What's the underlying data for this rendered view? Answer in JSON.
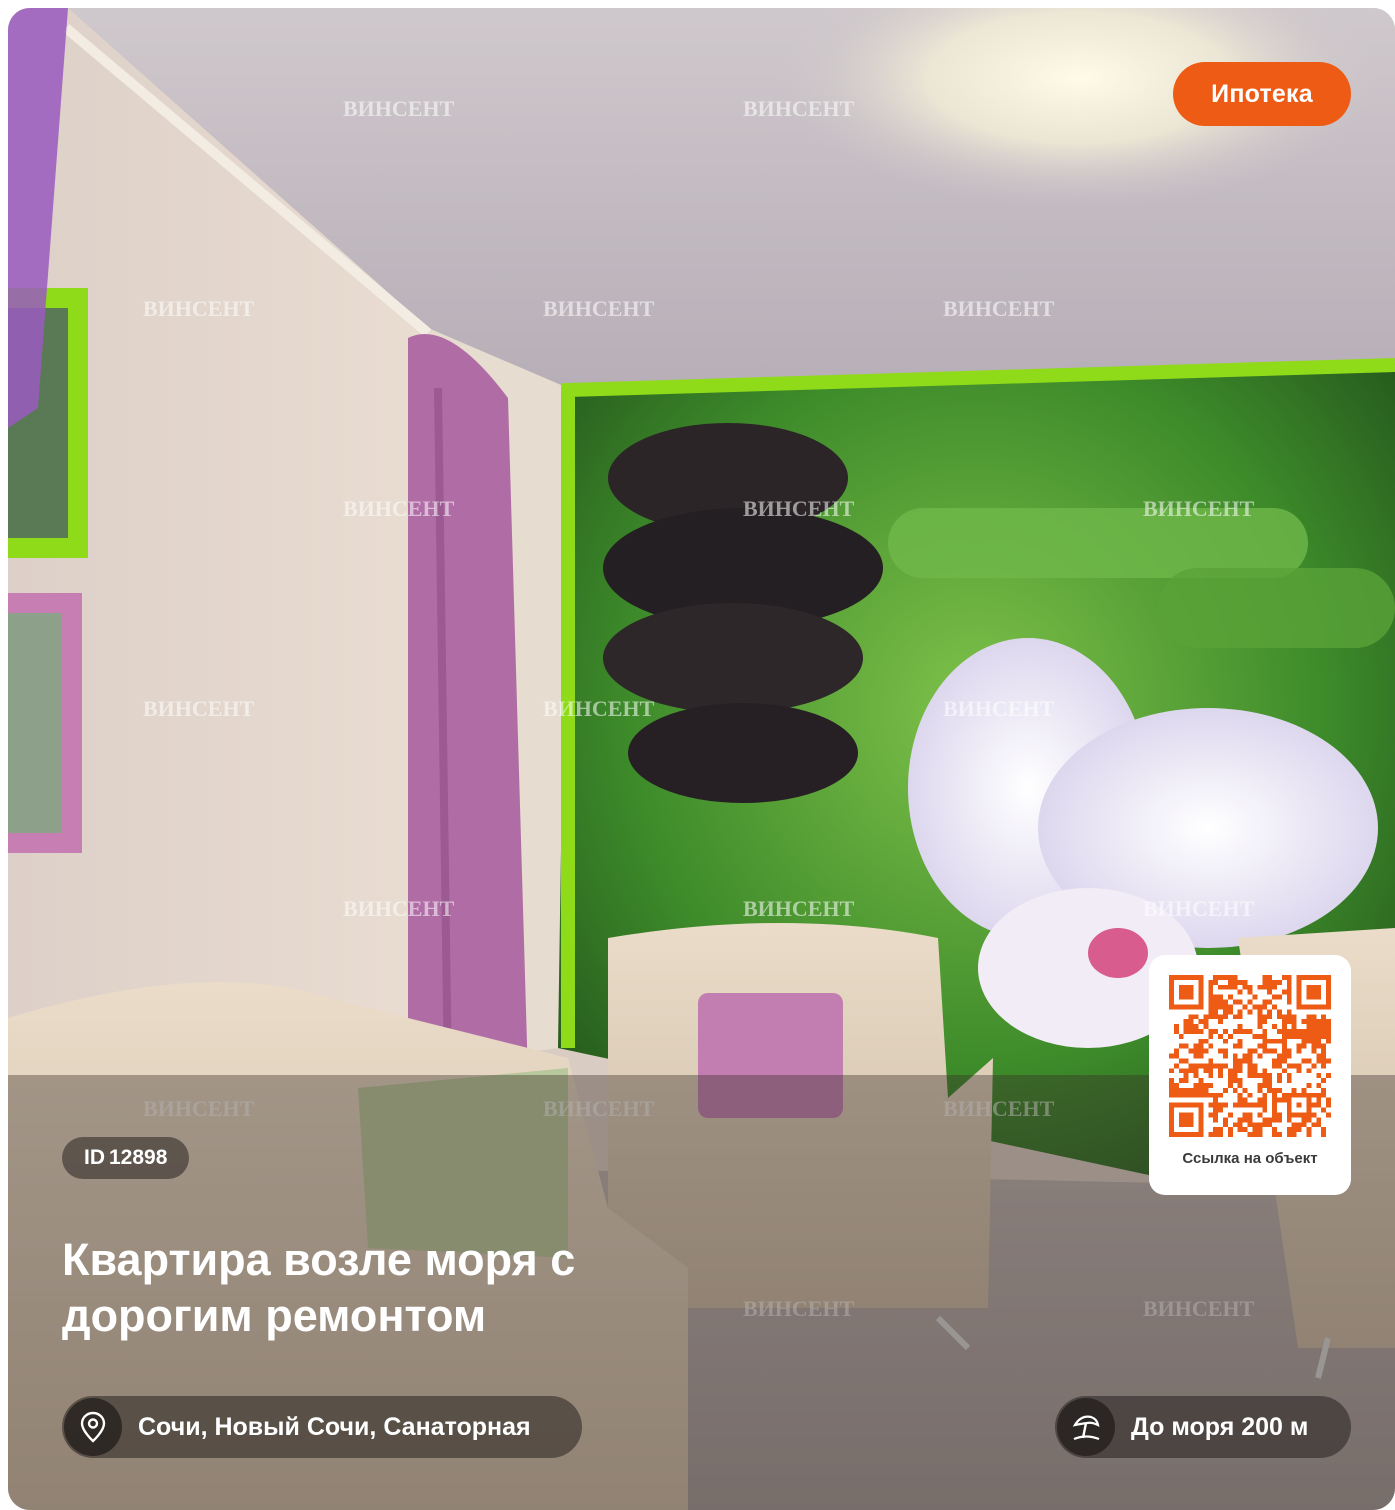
{
  "mortgage_label": "Ипотека",
  "id_prefix": "ID",
  "id_value": "12898",
  "title": "Квартира возле моря с дорогим ремонтом",
  "address": "Сочи, Новый Сочи, Санаторная",
  "sea_distance": "До моря 200 м",
  "qr_label": "Ссылка на объект",
  "watermark": "ВИНСЕНТ",
  "icons": {
    "location": "map-pin-icon",
    "sea": "beach-umbrella-icon"
  },
  "colors": {
    "accent": "#ee5b14",
    "qr": "#ee5b14"
  }
}
